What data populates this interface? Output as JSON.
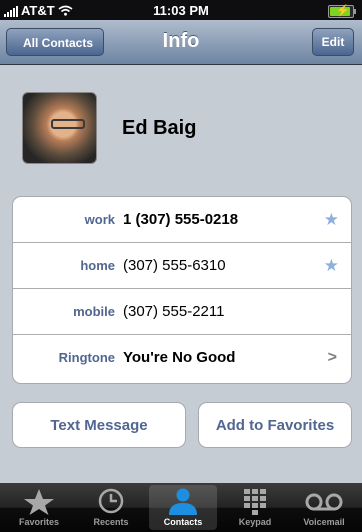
{
  "status_bar": {
    "carrier": "AT&T",
    "time": "11:03 PM"
  },
  "nav": {
    "back_label": "All Contacts",
    "title": "Info",
    "edit_label": "Edit"
  },
  "contact": {
    "name": "Ed Baig"
  },
  "phones": [
    {
      "label": "work",
      "value": "1 (307) 555-0218",
      "favorite": true
    },
    {
      "label": "home",
      "value": "(307) 555-6310",
      "favorite": true
    },
    {
      "label": "mobile",
      "value": "(307) 555-2211",
      "favorite": false
    }
  ],
  "ringtone": {
    "label": "Ringtone",
    "value": "You're No Good"
  },
  "actions": {
    "text_message": "Text Message",
    "add_favorites": "Add to Favorites"
  },
  "tabs": [
    {
      "label": "Favorites",
      "icon": "star-icon"
    },
    {
      "label": "Recents",
      "icon": "clock-icon"
    },
    {
      "label": "Contacts",
      "icon": "person-icon",
      "active": true
    },
    {
      "label": "Keypad",
      "icon": "keypad-icon"
    },
    {
      "label": "Voicemail",
      "icon": "voicemail-icon"
    }
  ],
  "colors": {
    "label_blue": "#516691",
    "star_blue": "#8fb0de",
    "background": "#c5ccd4",
    "active_tab": "#1e8fe0"
  }
}
